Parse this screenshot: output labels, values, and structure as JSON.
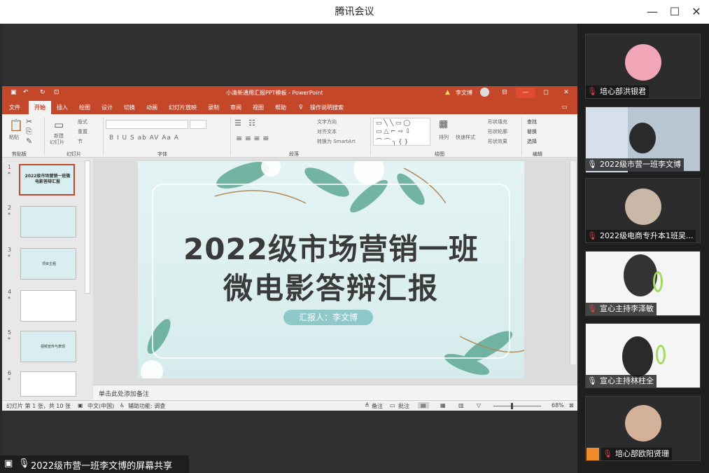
{
  "window": {
    "title": "腾讯会议",
    "minimize": "—",
    "maximize": "☐",
    "close": "✕"
  },
  "ppt": {
    "title": "小清新通用汇报PPT模板  -  PowerPoint",
    "warning": "▲",
    "user": "李文博",
    "tabs": [
      "文件",
      "开始",
      "插入",
      "绘图",
      "设计",
      "切换",
      "动画",
      "幻灯片放映",
      "录制",
      "审阅",
      "视图",
      "帮助",
      "操作说明搜索"
    ],
    "ribbon": {
      "paste": "粘贴",
      "new_slide": "新建",
      "new_slide2": "幻灯片",
      "layout": "版式",
      "reset": "重置",
      "section": "节",
      "font_buttons": "B  I  U  S  ab  AV  Aa  A",
      "text_dir": "文字方向",
      "align_text": "对齐文本",
      "smartart": "转换为 SmartArt",
      "arrange": "排列",
      "quick_styles": "快速样式",
      "shape_fill": "形状填充",
      "shape_outline": "形状轮廓",
      "shape_effects": "形状效果",
      "find": "查找",
      "replace": "替换",
      "select": "选择",
      "groups": [
        "剪贴板",
        "幻灯片",
        "字体",
        "段落",
        "绘图",
        "编辑"
      ]
    },
    "thumbs": [
      {
        "num": "1",
        "star": "*",
        "caption": "2022级市场营销一班微电影答辩汇报"
      },
      {
        "num": "2",
        "star": "*",
        "caption": ""
      },
      {
        "num": "3",
        "star": "*",
        "caption": "项目主题"
      },
      {
        "num": "4",
        "star": "*",
        "caption": ""
      },
      {
        "num": "5",
        "star": "*",
        "caption": "视频宣传与表现"
      },
      {
        "num": "6",
        "star": "*",
        "caption": ""
      }
    ],
    "slide": {
      "line1": "2022级市场营销一班",
      "line2": "微电影答辩汇报",
      "presenter": "汇报人：李文博"
    },
    "notes": "单击此处添加备注",
    "status": {
      "slide_info": "幻灯片 第 1 张，共 10 张",
      "language": "中文(中国)",
      "accessibility": "辅助功能: 调查",
      "notes_btn": "备注",
      "comments_btn": "批注",
      "zoom": "68%"
    }
  },
  "share_banner": "2022级市营一班李文博的屏幕共享",
  "participants": [
    {
      "name": "培心部洪银君",
      "muted": true
    },
    {
      "name": "2022级市营一班李文博",
      "muted": false
    },
    {
      "name": "2022级电商专升本1班吴...",
      "muted": true
    },
    {
      "name": "宣心主持李泽敏",
      "muted": true
    },
    {
      "name": "宣心主持林柱全",
      "muted": false
    },
    {
      "name": "培心部欧阳贤珊",
      "muted": true
    }
  ],
  "colors": {
    "ppt_accent": "#c5472a",
    "slide_pill": "#8ec8c8"
  }
}
